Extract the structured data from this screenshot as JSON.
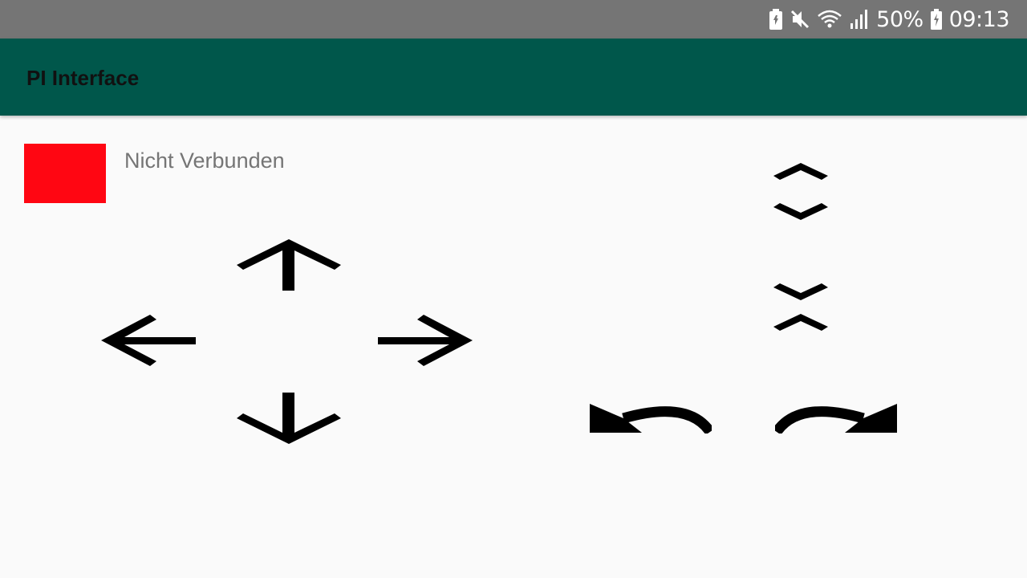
{
  "status_bar": {
    "battery_percent": "50%",
    "time": "09:13",
    "icons": [
      "battery-saver-icon",
      "mute-icon",
      "wifi-icon",
      "signal-icon",
      "battery-icon"
    ]
  },
  "app_bar": {
    "title": "PI Interface",
    "color": "#00574b"
  },
  "connection": {
    "status_text": "Nicht Verbunden",
    "indicator_color": "#ff0612"
  },
  "controls": {
    "movement": [
      "arrow-up-icon",
      "arrow-left-icon",
      "arrow-right-icon",
      "arrow-down-icon"
    ],
    "vertical": [
      "expand-icon",
      "collapse-icon"
    ],
    "rotation": [
      "rotate-left-icon",
      "rotate-right-icon"
    ]
  }
}
